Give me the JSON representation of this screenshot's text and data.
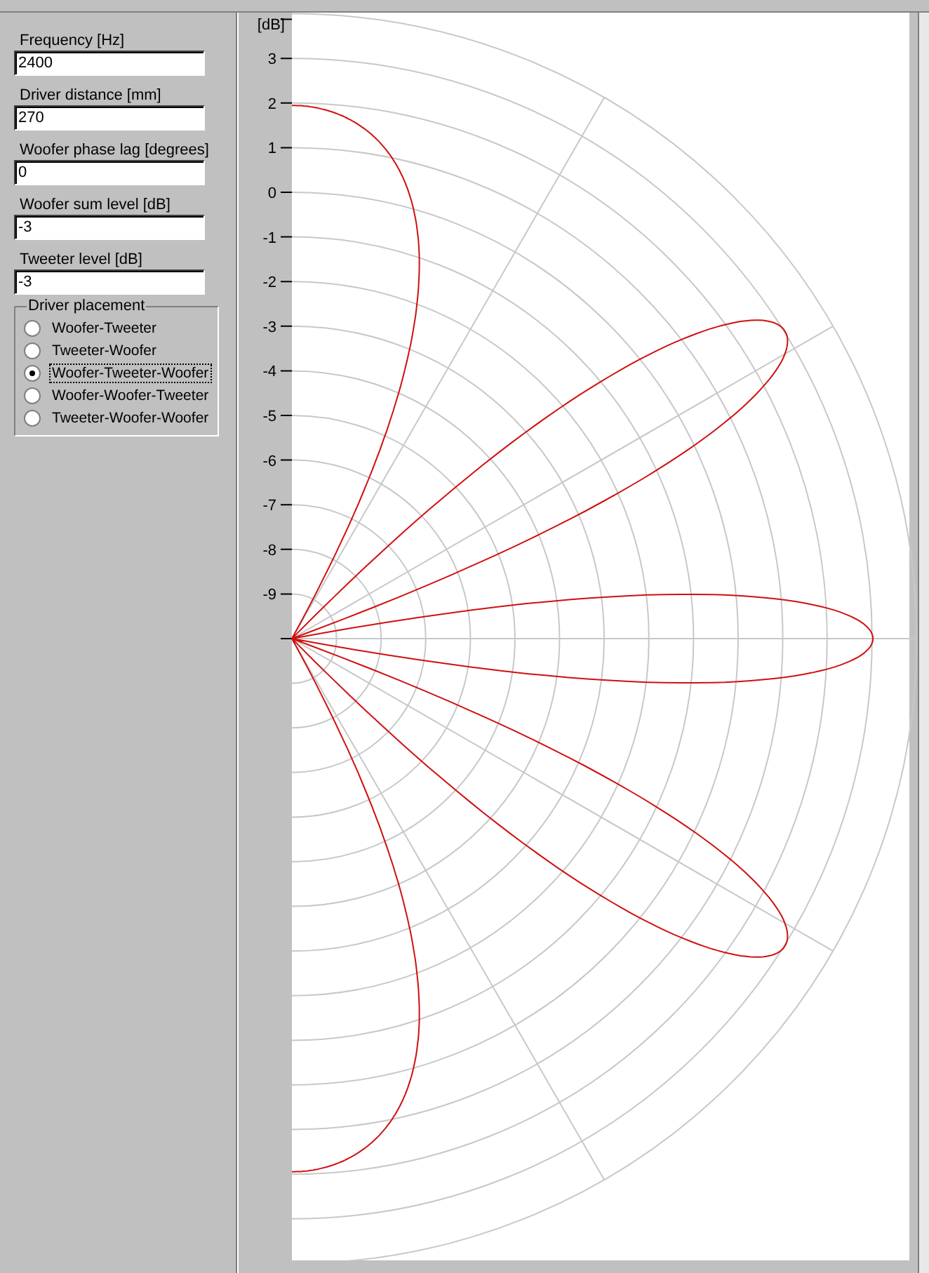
{
  "fields": [
    {
      "label": "Frequency [Hz]",
      "value": "2400"
    },
    {
      "label": "Driver distance [mm]",
      "value": "270"
    },
    {
      "label": "Woofer phase lag [degrees]",
      "value": "0"
    },
    {
      "label": "Woofer sum level [dB]",
      "value": "-3"
    },
    {
      "label": "Tweeter level [dB]",
      "value": "-3"
    }
  ],
  "driver_placement": {
    "title": "Driver placement",
    "options": [
      {
        "label": "Woofer-Tweeter",
        "selected": false
      },
      {
        "label": "Tweeter-Woofer",
        "selected": false
      },
      {
        "label": "Woofer-Tweeter-Woofer",
        "selected": true
      },
      {
        "label": "Woofer-Woofer-Tweeter",
        "selected": false
      },
      {
        "label": "Tweeter-Woofer-Woofer",
        "selected": false
      }
    ]
  },
  "polar_plot": {
    "unit_label": "[dB]",
    "tick_labels": [
      "3",
      "2",
      "1",
      "0",
      "-1",
      "-2",
      "-3",
      "-4",
      "-5",
      "-6",
      "-7",
      "-8",
      "-9"
    ]
  }
}
